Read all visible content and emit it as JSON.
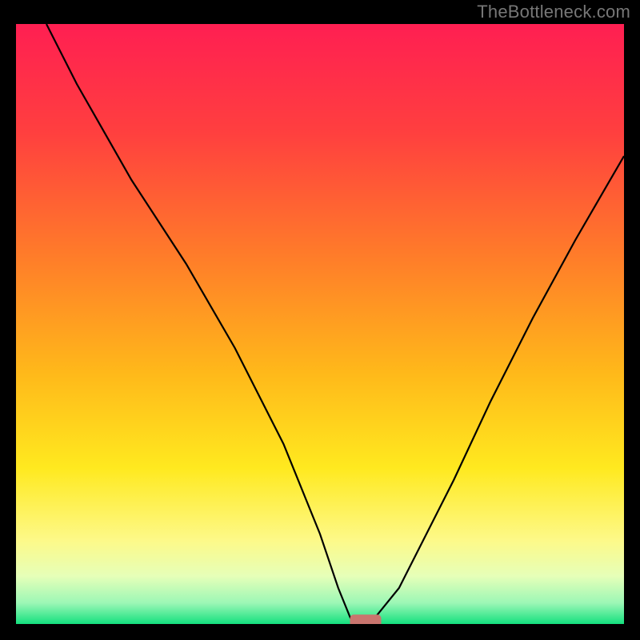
{
  "watermark": "TheBottleneck.com",
  "chart_data": {
    "type": "line",
    "title": "",
    "xlabel": "",
    "ylabel": "",
    "xlim": [
      0,
      100
    ],
    "ylim": [
      0,
      100
    ],
    "gradient_stops": [
      {
        "offset": 0.0,
        "color": "#ff1f52"
      },
      {
        "offset": 0.18,
        "color": "#ff3f3f"
      },
      {
        "offset": 0.38,
        "color": "#ff7a2a"
      },
      {
        "offset": 0.58,
        "color": "#ffb81a"
      },
      {
        "offset": 0.74,
        "color": "#ffe91f"
      },
      {
        "offset": 0.86,
        "color": "#fdf988"
      },
      {
        "offset": 0.92,
        "color": "#e6ffb8"
      },
      {
        "offset": 0.965,
        "color": "#9cf7b6"
      },
      {
        "offset": 1.0,
        "color": "#14e07e"
      }
    ],
    "series": [
      {
        "name": "bottleneck-curve",
        "x": [
          5,
          10,
          19,
          28,
          36,
          44,
          50,
          53,
          55,
          57,
          59,
          63,
          67,
          72,
          78,
          85,
          92,
          100
        ],
        "values": [
          100,
          90,
          74,
          60,
          46,
          30,
          15,
          6,
          1,
          0,
          1,
          6,
          14,
          24,
          37,
          51,
          64,
          78
        ]
      }
    ],
    "marker": {
      "x_center": 57.5,
      "y_center": 0.5,
      "width": 5,
      "height": 2
    },
    "curve_color": "#000000",
    "marker_color": "#c9756e"
  }
}
